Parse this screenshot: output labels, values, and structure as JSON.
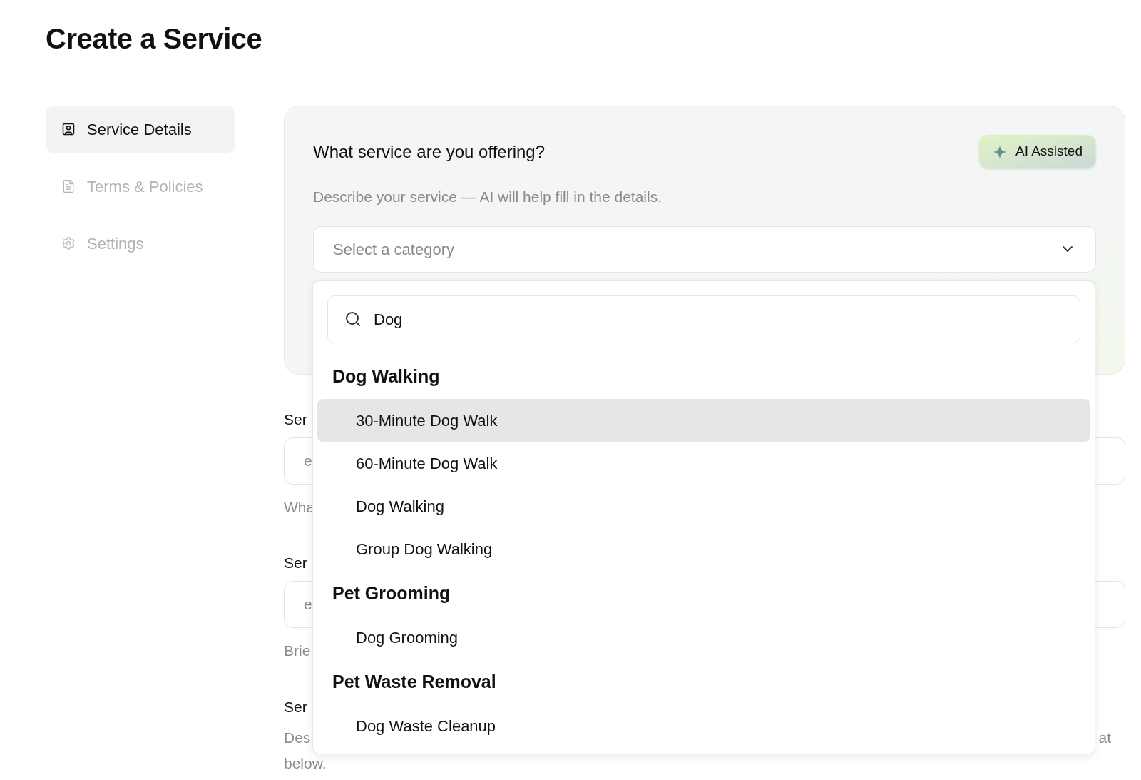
{
  "page": {
    "title": "Create a Service"
  },
  "sidebar": {
    "items": [
      {
        "label": "Service Details",
        "kind": "profile",
        "selected": true
      },
      {
        "label": "Terms & Policies",
        "kind": "document",
        "selected": false
      },
      {
        "label": "Settings",
        "kind": "gear",
        "selected": false
      }
    ]
  },
  "ai_card": {
    "heading": "What service are you offering?",
    "badge": "AI Assisted",
    "description": "Describe your service — AI will help fill in the details.",
    "category_select": {
      "placeholder": "Select a category",
      "expanded": true
    }
  },
  "category_dropdown": {
    "search": {
      "value": "Dog"
    },
    "groups": [
      {
        "heading": "Dog Walking",
        "options": [
          {
            "label": "30-Minute Dog Walk",
            "selected": true
          },
          {
            "label": "60-Minute Dog Walk",
            "selected": false
          },
          {
            "label": "Dog Walking",
            "selected": false
          },
          {
            "label": "Group Dog Walking",
            "selected": false
          }
        ]
      },
      {
        "heading": "Pet Grooming",
        "options": [
          {
            "label": "Dog Grooming",
            "selected": false
          }
        ]
      },
      {
        "heading": "Pet Waste Removal",
        "options": [
          {
            "label": "Dog Waste Cleanup",
            "selected": false
          }
        ]
      }
    ]
  },
  "form_fields": [
    {
      "kind": "input",
      "label": "Ser",
      "placeholder": "e",
      "hint": "Wha"
    },
    {
      "kind": "input",
      "label": "Ser",
      "placeholder": "e",
      "hint": "Brie"
    },
    {
      "kind": "text",
      "label": "Ser",
      "hint": "Des",
      "hint_end": "at",
      "hint_line2": "below."
    }
  ]
}
